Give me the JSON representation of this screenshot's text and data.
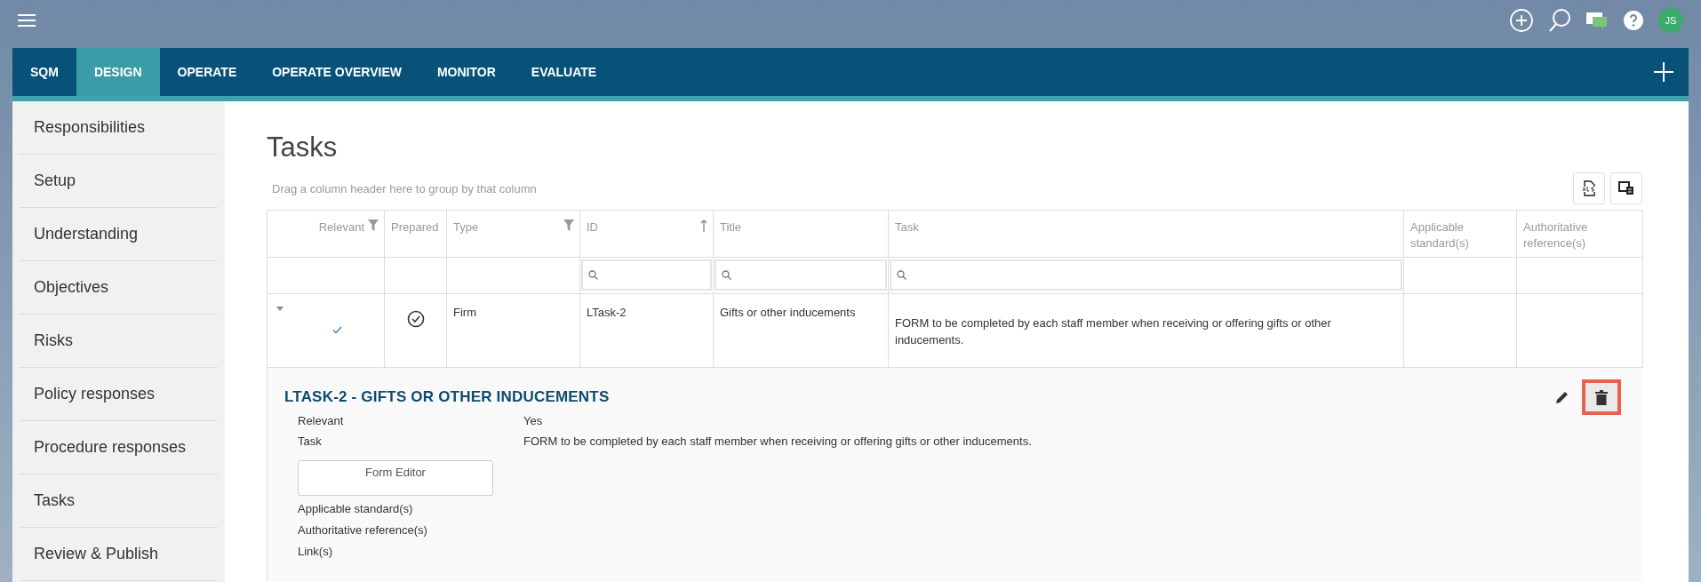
{
  "top_bar": {
    "avatar_initials": "JS"
  },
  "nav_tabs": [
    {
      "label": "SQM",
      "selected": false
    },
    {
      "label": "DESIGN",
      "selected": true
    },
    {
      "label": "OPERATE",
      "selected": false
    },
    {
      "label": "OPERATE OVERVIEW",
      "selected": false
    },
    {
      "label": "MONITOR",
      "selected": false
    },
    {
      "label": "EVALUATE",
      "selected": false
    }
  ],
  "sidebar": {
    "items": [
      {
        "label": "Responsibilities"
      },
      {
        "label": "Setup"
      },
      {
        "label": "Understanding"
      },
      {
        "label": "Objectives"
      },
      {
        "label": "Risks"
      },
      {
        "label": "Policy responses"
      },
      {
        "label": "Procedure responses"
      },
      {
        "label": "Tasks"
      },
      {
        "label": "Review & Publish"
      }
    ]
  },
  "page": {
    "title": "Tasks",
    "group_hint": "Drag a column header here to group by that column"
  },
  "table": {
    "columns": [
      {
        "label": "Relevant",
        "kind": "filterable",
        "searchable": false
      },
      {
        "label": "Prepared",
        "kind": "plain",
        "searchable": false
      },
      {
        "label": "Type",
        "kind": "filterable",
        "searchable": false
      },
      {
        "label": "ID",
        "kind": "sorted",
        "searchable": true
      },
      {
        "label": "Title",
        "kind": "plain",
        "searchable": true
      },
      {
        "label": "Task",
        "kind": "plain",
        "searchable": true
      },
      {
        "label": "Applicable standard(s)",
        "kind": "plain",
        "searchable": false
      },
      {
        "label": "Authoritative reference(s)",
        "kind": "plain",
        "searchable": false
      }
    ],
    "rows": [
      {
        "expanded": true,
        "relevant": true,
        "prepared": true,
        "type": "Firm",
        "id": "LTask-2",
        "title": "Gifts or other inducements",
        "task": "FORM to be completed by each staff member when receiving or offering gifts or other inducements."
      }
    ]
  },
  "detail": {
    "heading": "LTASK-2 - GIFTS OR OTHER INDUCEMENTS",
    "delete_highlighted": true,
    "fields": [
      {
        "label": "Relevant",
        "value": "Yes"
      },
      {
        "label": "Task",
        "value": "FORM to be completed by each staff member when receiving or offering gifts or other inducements."
      }
    ],
    "form_button": "Form Editor",
    "labels": [
      "Applicable standard(s)",
      "Authoritative reference(s)",
      "Link(s)"
    ]
  }
}
